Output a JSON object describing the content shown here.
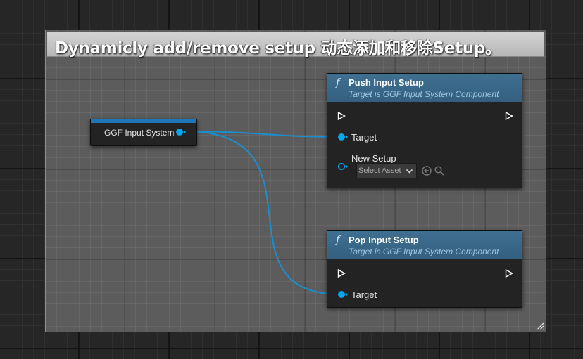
{
  "comment": {
    "title": "Dynamicly add/remove setup 动态添加和移除Setup。"
  },
  "ggf_node": {
    "label": "GGF Input System",
    "pin_icon": "object-pin-icon"
  },
  "push_node": {
    "title": "Push Input Setup",
    "subtitle": "Target is GGF Input System Component",
    "function_icon": "f",
    "target_label": "Target",
    "new_setup_label": "New Setup",
    "asset_select_value": "Select Asset"
  },
  "pop_node": {
    "title": "Pop Input Setup",
    "subtitle": "Target is GGF Input System Component",
    "function_icon": "f",
    "target_label": "Target"
  },
  "colors": {
    "object_pin": "#00a8f0",
    "wire": "#1a8fd0",
    "node_header": "#3a6a8c",
    "node_body": "#232323"
  }
}
